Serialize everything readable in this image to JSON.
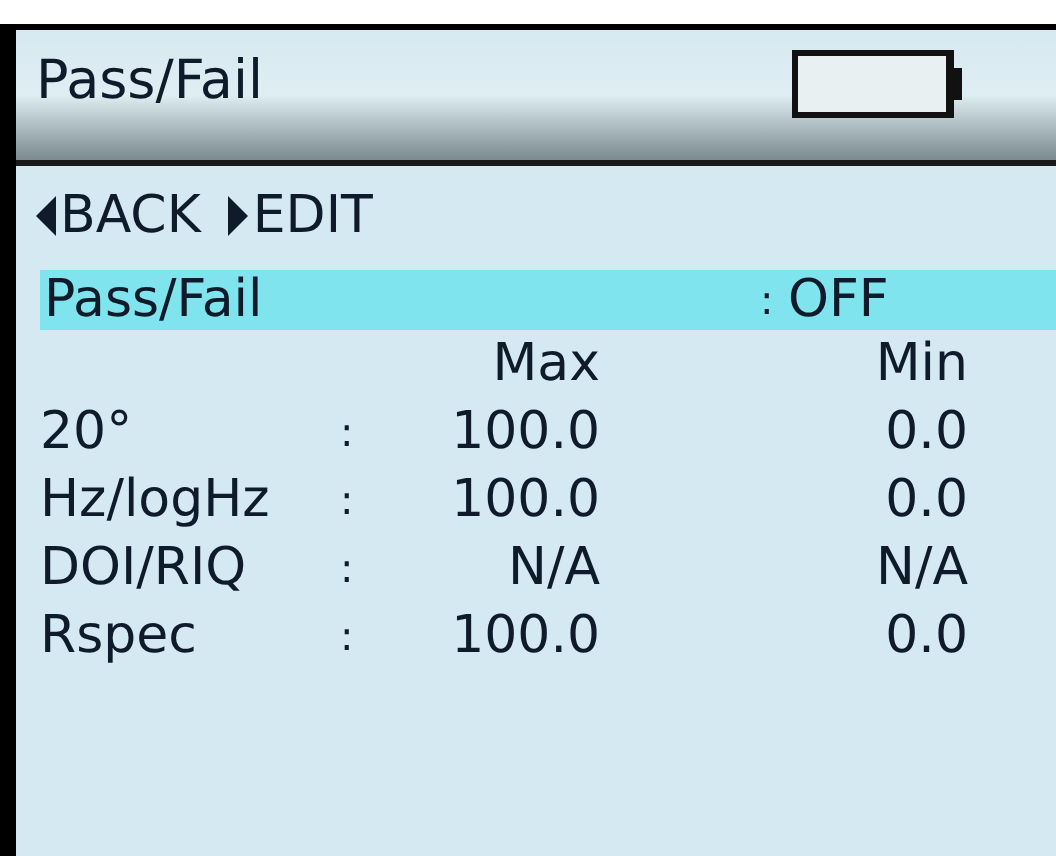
{
  "header": {
    "title": "Pass/Fail"
  },
  "softkeys": [
    {
      "kind": "left",
      "label": "BACK"
    },
    {
      "kind": "right",
      "label": "EDIT"
    }
  ],
  "setting": {
    "label": "Pass/Fail",
    "separator": ":",
    "value": "OFF",
    "selected": true
  },
  "table": {
    "columns": [
      "Max",
      "Min"
    ],
    "rows": [
      {
        "label": "20°",
        "separator": ":",
        "max": "100.0",
        "min": "0.0"
      },
      {
        "label": "Hz/logHz",
        "separator": ":",
        "max": "100.0",
        "min": "0.0"
      },
      {
        "label": "DOI/RIQ",
        "separator": ":",
        "max": "N/A",
        "min": "N/A"
      },
      {
        "label": "Rspec",
        "separator": ":",
        "max": "100.0",
        "min": "0.0"
      }
    ]
  }
}
